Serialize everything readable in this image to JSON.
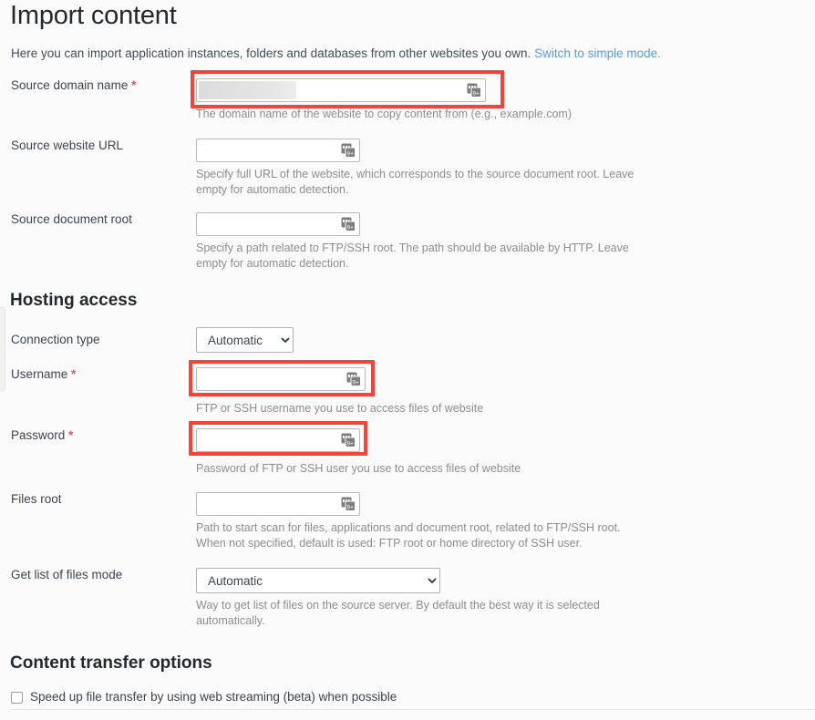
{
  "page": {
    "title": "Import content",
    "intro_text": "Here you can import application instances, folders and databases from other websites you own.",
    "intro_link": "Switch to simple mode.",
    "link_color": "#5b9bd5",
    "highlight_color": "#f4433a",
    "required_marker": "*"
  },
  "source": {
    "domain": {
      "label": "Source domain name",
      "required": true,
      "value": "",
      "placeholder": "",
      "hint": "The domain name of the website to copy content from (e.g., example.com)",
      "highlighted": true,
      "icon": "autofill-icon"
    },
    "website_url": {
      "label": "Source website URL",
      "required": false,
      "value": "",
      "placeholder": "",
      "hint": "Specify full URL of the website, which corresponds to the source document root. Leave empty for automatic detection.",
      "highlighted": false,
      "icon": "autofill-icon"
    },
    "document_root": {
      "label": "Source document root",
      "required": false,
      "value": "",
      "placeholder": "",
      "hint": "Specify a path related to FTP/SSH root. The path should be available by HTTP. Leave empty for automatic detection.",
      "highlighted": false,
      "icon": "autofill-icon"
    }
  },
  "hosting_access": {
    "heading": "Hosting access",
    "connection_type": {
      "label": "Connection type",
      "selected": "Automatic",
      "options": [
        "Automatic"
      ]
    },
    "username": {
      "label": "Username",
      "required": true,
      "value": "",
      "placeholder": "",
      "hint": "FTP or SSH username you use to access files of website",
      "highlighted": true,
      "icon": "autofill-icon"
    },
    "password": {
      "label": "Password",
      "required": true,
      "value": "",
      "placeholder": "",
      "hint": "Password of FTP or SSH user you use to access files of website",
      "highlighted": true,
      "icon": "autofill-icon"
    },
    "files_root": {
      "label": "Files root",
      "required": false,
      "value": "",
      "placeholder": "",
      "hint": "Path to start scan for files, applications and document root, related to FTP/SSH root. When not specified, default is used: FTP root or home directory of SSH user.",
      "highlighted": false,
      "icon": "autofill-icon"
    },
    "files_mode": {
      "label": "Get list of files mode",
      "selected": "Automatic",
      "options": [
        "Automatic"
      ],
      "hint": "Way to get list of files on the source server. By default the best way it is selected automatically."
    }
  },
  "content_transfer": {
    "heading": "Content transfer options",
    "web_streaming": {
      "label": "Speed up file transfer by using web streaming (beta) when possible",
      "checked": false
    }
  }
}
